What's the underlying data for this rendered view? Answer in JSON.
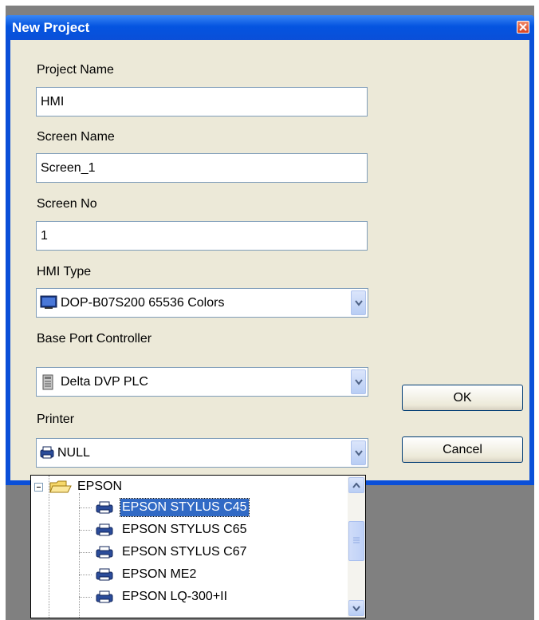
{
  "window": {
    "title": "New Project"
  },
  "form": {
    "project_name_label": "Project Name",
    "project_name_value": "HMI",
    "screen_name_label": "Screen Name",
    "screen_name_value": "Screen_1",
    "screen_no_label": "Screen No",
    "screen_no_value": "1",
    "hmi_type_label": "HMI Type",
    "hmi_type_value": "DOP-B07S200 65536 Colors",
    "base_port_label": "Base Port Controller",
    "base_port_value": "Delta DVP PLC",
    "printer_label": "Printer",
    "printer_value": "NULL"
  },
  "buttons": {
    "ok": "OK",
    "cancel": "Cancel"
  },
  "printer_list": {
    "group": "EPSON",
    "items": [
      "EPSON STYLUS C45",
      "EPSON STYLUS C65",
      "EPSON STYLUS C67",
      "EPSON ME2",
      "EPSON LQ-300+II"
    ],
    "selected_index": 0
  },
  "icons": {
    "close": "close-icon",
    "monitor": "monitor-icon",
    "plc": "plc-icon",
    "printer": "printer-icon",
    "folder": "open-folder-icon",
    "collapse": "tree-collapse-icon",
    "chevron": "chevron-down-icon"
  },
  "colors": {
    "titlebar": "#0a4fd8",
    "client": "#ece9d8",
    "selection": "#316ac5"
  }
}
